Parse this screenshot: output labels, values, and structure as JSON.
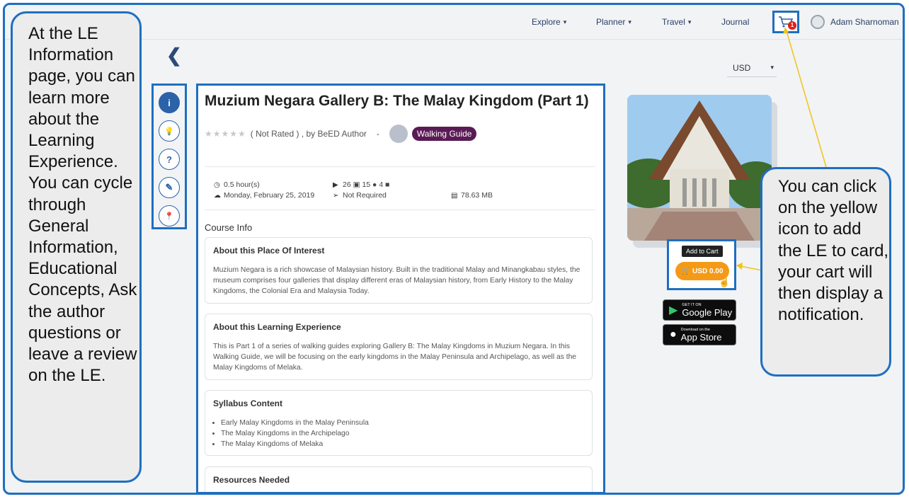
{
  "nav": {
    "explore": "Explore",
    "planner": "Planner",
    "travel": "Travel",
    "journal": "Journal",
    "caret": "▾",
    "cart_count": "1",
    "user_name": "Adam Sharnoman"
  },
  "currency": {
    "value": "USD",
    "arrow": "▾"
  },
  "tabs": [
    {
      "label": "i"
    },
    {
      "label": "💡"
    },
    {
      "label": "?"
    },
    {
      "label": "✎"
    },
    {
      "label": "📍"
    }
  ],
  "course": {
    "title": "Muzium Negara Gallery B: The Malay Kingdom (Part 1)",
    "stars": "★★★★★",
    "rating_text": "( Not Rated ) , by BeED Author",
    "separator": "-",
    "tag": "Walking Guide",
    "duration": "0.5 hour(s)",
    "date": "Monday, February 25, 2019",
    "media_images": "26",
    "media_audio": "15",
    "media_video": "4",
    "requirement": "Not Required",
    "size": "78.63 MB"
  },
  "section_label": "Course Info",
  "cards": [
    {
      "title": "About this Place Of Interest",
      "text": "Muzium Negara is a rich showcase of Malaysian history. Built in the traditional Malay and Minangkabau styles, the museum comprises four galleries that display different eras of Malaysian history, from Early History to the Malay Kingdoms, the Colonial Era and Malaysia Today."
    },
    {
      "title": "About this Learning Experience",
      "text": "This is Part 1 of a series of walking guides exploring Gallery B: The Malay Kingdoms in Muzium Negara. In this Walking Guide, we will be focusing on the early kingdoms in the Malay Peninsula and Archipelago, as well as the Malay Kingdoms of Melaka."
    },
    {
      "title": "Syllabus Content",
      "items": [
        "Early Malay Kingdoms in the Malay Peninsula",
        "The Malay Kingdoms in the Archipelago",
        "The Malay Kingdoms of Melaka"
      ]
    },
    {
      "title": "Resources Needed"
    }
  ],
  "purchase": {
    "tooltip": "Add to Cart",
    "price": "USD 0.00"
  },
  "stores": {
    "google_small": "GET IT ON",
    "google_big": "Google Play",
    "apple_small": "Download on the",
    "apple_big": "App Store"
  },
  "callouts": {
    "left": "At the LE Information page, you can learn more about the Learning Experience. You can cycle through General Information, Educational Concepts, Ask the author questions or leave a review on the LE.",
    "right": "You can click on the yellow icon to add the LE to card, your cart will then display a notification."
  },
  "colors": {
    "accent": "#1e6fc0",
    "tag_bg": "#5a1a55",
    "price_button": "#f59a16",
    "annotation_arrow": "#f0c419"
  }
}
